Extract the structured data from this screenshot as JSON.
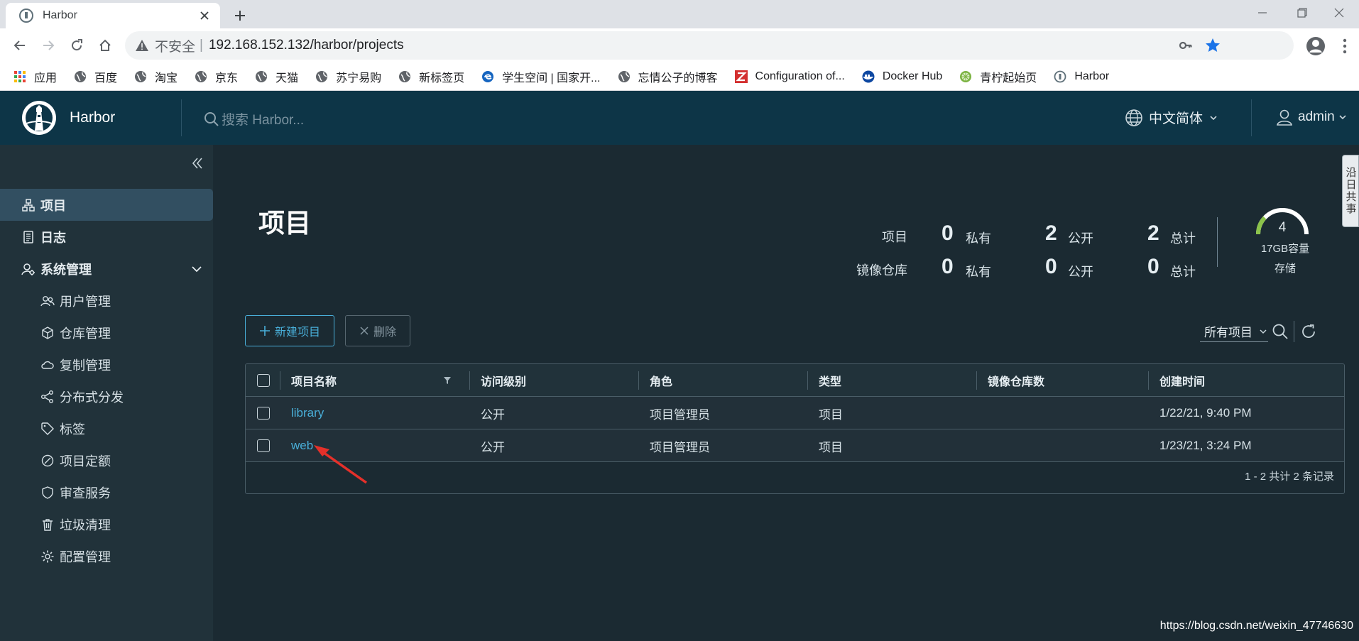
{
  "browser": {
    "tab_title": "Harbor",
    "insecure_label": "不安全",
    "separator": "|",
    "url": "192.168.152.132/harbor/projects",
    "bookmarks": [
      {
        "label": "应用",
        "icon": "apps-grid-icon"
      },
      {
        "label": "百度",
        "icon": "globe-icon"
      },
      {
        "label": "淘宝",
        "icon": "globe-icon"
      },
      {
        "label": "京东",
        "icon": "globe-icon"
      },
      {
        "label": "天猫",
        "icon": "globe-icon"
      },
      {
        "label": "苏宁易购",
        "icon": "globe-icon"
      },
      {
        "label": "新标签页",
        "icon": "globe-icon"
      },
      {
        "label": "学生空间 | 国家开...",
        "icon": "edge-icon"
      },
      {
        "label": "忘情公子的博客",
        "icon": "globe-icon"
      },
      {
        "label": "Configuration of...",
        "icon": "z-icon"
      },
      {
        "label": "Docker Hub",
        "icon": "docker-icon"
      },
      {
        "label": "青柠起始页",
        "icon": "lime-icon"
      },
      {
        "label": "Harbor",
        "icon": "harbor-icon"
      }
    ]
  },
  "header": {
    "brand": "Harbor",
    "search_placeholder": "搜索 Harbor...",
    "language": "中文简体",
    "user": "admin"
  },
  "sidebar": {
    "items": [
      {
        "label": "项目",
        "icon": "projects-icon",
        "active": true
      },
      {
        "label": "日志",
        "icon": "logs-icon"
      },
      {
        "label": "系统管理",
        "icon": "admin-icon",
        "expanded": true
      }
    ],
    "subitems": [
      {
        "label": "用户管理",
        "icon": "users-icon"
      },
      {
        "label": "仓库管理",
        "icon": "registry-icon"
      },
      {
        "label": "复制管理",
        "icon": "replication-icon"
      },
      {
        "label": "分布式分发",
        "icon": "share-icon"
      },
      {
        "label": "标签",
        "icon": "tag-icon"
      },
      {
        "label": "项目定额",
        "icon": "quota-icon"
      },
      {
        "label": "审查服务",
        "icon": "shield-icon"
      },
      {
        "label": "垃圾清理",
        "icon": "trash-icon"
      },
      {
        "label": "配置管理",
        "icon": "gear-icon"
      }
    ]
  },
  "main": {
    "title": "项目",
    "stats": {
      "projects_label": "项目",
      "repos_label": "镜像仓库",
      "private_label": "私有",
      "public_label": "公开",
      "total_label": "总计",
      "projects": {
        "private": "0",
        "public": "2",
        "total": "2"
      },
      "repos": {
        "private": "0",
        "public": "0",
        "total": "0"
      }
    },
    "storage": {
      "value": "4",
      "capacity": "17GB容量",
      "label": "存储",
      "used_fraction": 0.24
    },
    "new_project_label": "新建项目",
    "delete_label": "删除",
    "filter_label": "所有项目",
    "table": {
      "headers": [
        "项目名称",
        "访问级别",
        "角色",
        "类型",
        "镜像仓库数",
        "创建时间"
      ],
      "rows": [
        {
          "name": "library",
          "access": "公开",
          "role": "项目管理员",
          "type": "项目",
          "repos": "",
          "created": "1/22/21, 9:40 PM"
        },
        {
          "name": "web",
          "access": "公开",
          "role": "项目管理员",
          "type": "项目",
          "repos": "",
          "created": "1/23/21, 3:24 PM"
        }
      ],
      "footer": "1 - 2 共计 2 条记录"
    }
  },
  "side_tab": "沿日共事",
  "watermark": "https://blog.csdn.net/weixin_47746630",
  "colors": {
    "accent": "#49afd9",
    "header_bg": "#0d3547",
    "sidebar_bg": "#21323a",
    "main_bg": "#1b2a32",
    "annotation_arrow": "#e5302a"
  }
}
